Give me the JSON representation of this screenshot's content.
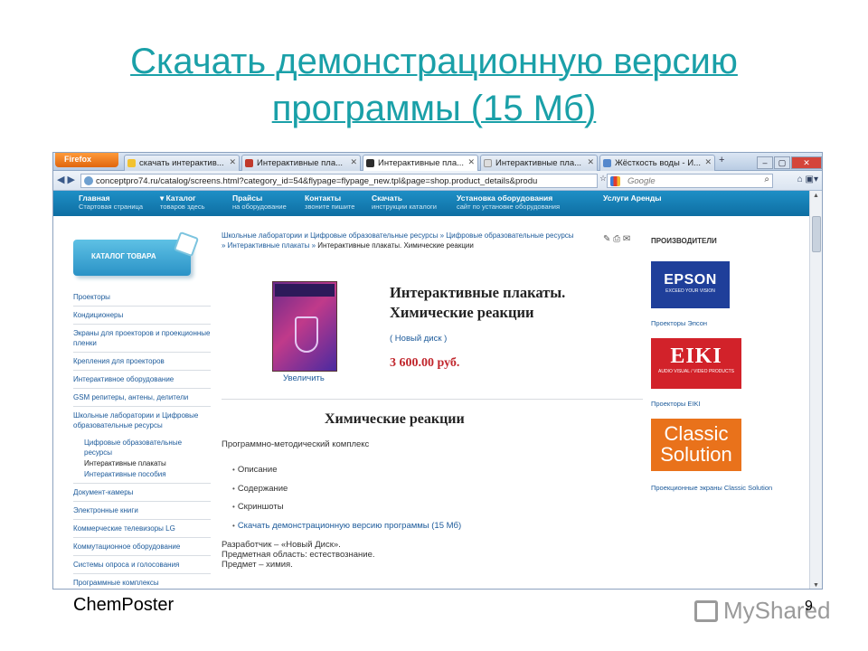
{
  "slide": {
    "title_line1": "Скачать демонстрационную версию",
    "title_line2": "программы (15 Мб)",
    "footer_left": "ChemPoster",
    "watermark": "MyShared",
    "page_number": "9"
  },
  "browser": {
    "firefox_label": "Firefox",
    "tabs": [
      {
        "label": "скачать интерактив...",
        "icon_color": "#f2c230",
        "active": false
      },
      {
        "label": "Интерактивные пла...",
        "icon_color": "#c0392b",
        "active": false
      },
      {
        "label": "Интерактивные пла...",
        "icon_color": "#2d2d2d",
        "active": true
      },
      {
        "label": "Интерактивные пла...",
        "icon_color": "#dddddd",
        "active": false
      },
      {
        "label": "Жёсткость воды - И...",
        "icon_color": "#5588cc",
        "active": false
      }
    ],
    "add_tab": "+",
    "url": "conceptpro74.ru/catalog/screens.html?category_id=54&flypage=flypage_new.tpl&page=shop.product_details&produ",
    "search_placeholder": "Google"
  },
  "topnav": [
    {
      "title": "Главная",
      "sub": "Стартовая страница"
    },
    {
      "title": "▾ Каталог",
      "sub": "товаров здесь"
    },
    {
      "title": "Прайсы",
      "sub": "на оборудование"
    },
    {
      "title": "Контакты",
      "sub": "звоните пишите"
    },
    {
      "title": "Скачать",
      "sub": "инструкции каталоги"
    },
    {
      "title": "Установка оборудования",
      "sub": "сайт по установке оборудования"
    },
    {
      "title": "Услуги Аренды",
      "sub": ""
    }
  ],
  "sidebar": {
    "banner": "КАТАЛОГ ТОВАРА",
    "items": [
      {
        "label": "Проекторы",
        "kind": "item"
      },
      {
        "label": "Кондиционеры",
        "kind": "item"
      },
      {
        "label": "Экраны для проекторов и проекционные пленки",
        "kind": "item"
      },
      {
        "label": "Крепления для проекторов",
        "kind": "item"
      },
      {
        "label": "Интерактивное оборудование",
        "kind": "item"
      },
      {
        "label": "GSM репитеры, антены, делители",
        "kind": "item"
      },
      {
        "label": "Школьные лаборатории и Цифровые образовательные ресурсы",
        "kind": "item"
      },
      {
        "label": "Цифровые образовательные ресурсы",
        "kind": "sub"
      },
      {
        "label": "Интерактивные плакаты",
        "kind": "dark"
      },
      {
        "label": "Интерактивные пособия",
        "kind": "sub"
      },
      {
        "label": "Документ-камеры",
        "kind": "item"
      },
      {
        "label": "Электронные книги",
        "kind": "item"
      },
      {
        "label": "Коммерческие телевизоры LG",
        "kind": "item"
      },
      {
        "label": "Коммутационное оборудование",
        "kind": "item"
      },
      {
        "label": "Системы опроса и голосования",
        "kind": "item"
      },
      {
        "label": "Программные комплексы",
        "kind": "item"
      }
    ]
  },
  "breadcrumb": {
    "part1": "Школьные лаборатории и Цифровые образовательные ресурсы",
    "sep": " » ",
    "part2": "Цифровые образовательные ресурсы",
    "part3": "Интерактивные плакаты",
    "current": "Интерактивные плакаты. Химические реакции"
  },
  "product": {
    "enlarge": "Увеличить",
    "title_line1": "Интерактивные плакаты.",
    "title_line2": "Химические реакции",
    "publisher_link": "( Новый диск )",
    "price": "3 600.00 руб.",
    "section_title": "Химические реакции",
    "kit": "Программно-методический комплекс",
    "links": [
      {
        "label": "Описание",
        "link": false
      },
      {
        "label": "Содержание",
        "link": false
      },
      {
        "label": "Скриншоты",
        "link": false
      },
      {
        "label": "Скачать демонстрационную версию программы (15 Мб)",
        "link": true
      }
    ],
    "developer": "Разработчик – «Новый Диск».",
    "subject_area": "Предметная область: естествознание.",
    "subject": "Предмет – химия."
  },
  "vendors": {
    "heading": "ПРОИЗВОДИТЕЛИ",
    "epson_logo": "EPSON",
    "epson_tagline": "EXCEED YOUR VISION",
    "epson_caption": "Проекторы Эпсон",
    "eiki_logo": "EIKI",
    "eiki_tagline": "AUDIO VISUAL / VIDEO PRODUCTS",
    "eiki_caption": "Проекторы EIKI",
    "cs_logo_1": "Classic",
    "cs_logo_2": "Solution",
    "cs_caption": "Проекционные экраны Classic Solution"
  },
  "colors": {
    "title_teal": "#1aa0a8",
    "link_blue": "#1c5a9a",
    "price_red": "#c1272d",
    "nav_blue": "#1480b8"
  }
}
